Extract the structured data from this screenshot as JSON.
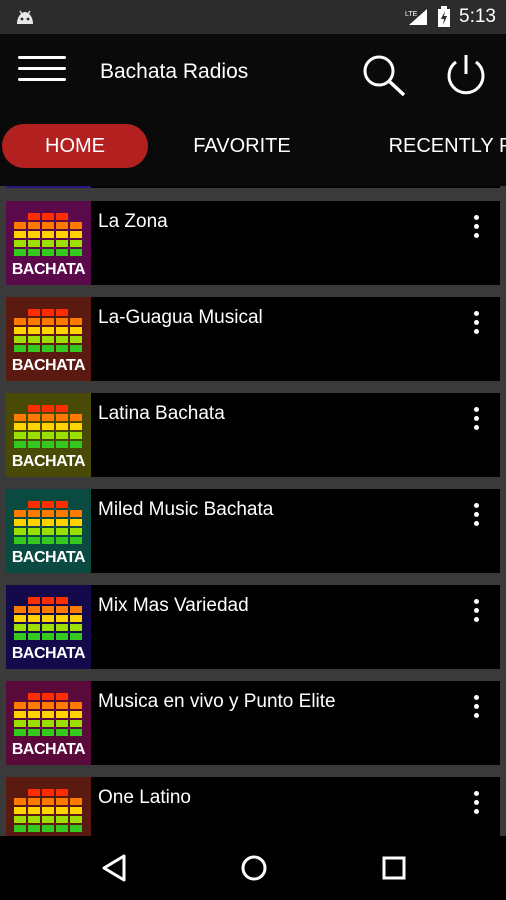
{
  "status": {
    "time": "5:13",
    "network": "LTE"
  },
  "app": {
    "title": "Bachata Radios"
  },
  "tabs": [
    {
      "label": "HOME",
      "active": true
    },
    {
      "label": "FAVORITE",
      "active": false
    },
    {
      "label": "RECENTLY PL",
      "active": false
    }
  ],
  "thumb_label": "BACHATA",
  "stations": [
    {
      "name": "La Zona",
      "bg": "#5a0a4a"
    },
    {
      "name": "La-Guagua Musical",
      "bg": "#5a1a12"
    },
    {
      "name": "Latina Bachata",
      "bg": "#4a4a08"
    },
    {
      "name": "Miled Music Bachata",
      "bg": "#0a4a40"
    },
    {
      "name": "Mix Mas Variedad",
      "bg": "#120a4a"
    },
    {
      "name": "Musica en vivo y Punto Elite",
      "bg": "#5a0a3a"
    },
    {
      "name": "One Latino",
      "bg": "#5a1a12"
    }
  ],
  "colors": {
    "accent": "#b32020",
    "appbar": "#0a0a0a",
    "card": "#000000",
    "background": "#3a3a3a"
  }
}
